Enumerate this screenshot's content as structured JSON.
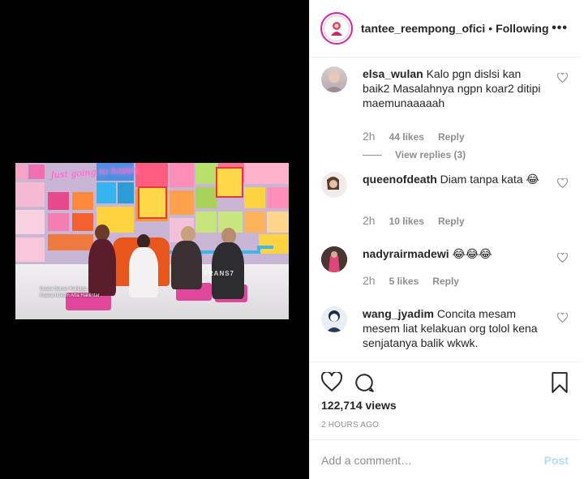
{
  "video": {
    "neon_sign": "Just going to happy",
    "caption_line1": "Suara Sunan Kalijaga",
    "caption_line2": "Kuasa hukum Atta Halilintar",
    "watermark": "TRANS7"
  },
  "header": {
    "username": "tantee_reempong_ofici",
    "separator": "•",
    "follow_status": "Following",
    "more": "•••"
  },
  "comments": [
    {
      "user": "elsa_wulan",
      "text": "Kalo pgn dislsi kan baik2 Masalahnya ngpn koar2 ditipi maemunaaaaah",
      "time": "2h",
      "likes": "44 likes",
      "reply": "Reply",
      "view_replies": "View replies (3)"
    },
    {
      "user": "queenofdeath",
      "text": "Diam tanpa kata 😂",
      "time": "2h",
      "likes": "10 likes",
      "reply": "Reply"
    },
    {
      "user": "nadyrairmadewi",
      "text": "😂😂😂",
      "time": "2h",
      "likes": "5 likes",
      "reply": "Reply"
    },
    {
      "user": "wang_jyadim",
      "text": "Concita mesam mesem liat kelakuan org tolol kena senjatanya balik wkwk.",
      "time": "",
      "likes": "",
      "reply": ""
    }
  ],
  "footer": {
    "views": "122,714 views",
    "posted": "2 HOURS AGO",
    "comment_placeholder": "Add a comment…",
    "post_label": "Post"
  },
  "colors": {
    "accent": "#0095f6",
    "post_disabled": "#b3dbff",
    "muted": "#8e8e8e",
    "text": "#262626"
  }
}
